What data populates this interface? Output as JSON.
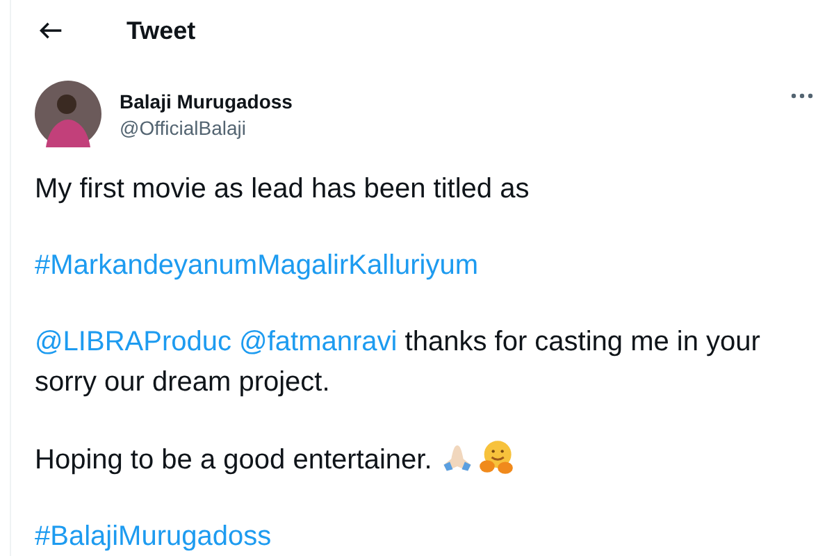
{
  "header": {
    "title": "Tweet"
  },
  "author": {
    "name": "Balaji Murugadoss",
    "handle": "@OfficialBalaji"
  },
  "paragraphs": [
    {
      "segments": [
        {
          "kind": "text",
          "text": "My first movie as lead has been titled as"
        }
      ]
    },
    {
      "segments": [
        {
          "kind": "link",
          "text": "#MarkandeyanumMagalirKalluriyum"
        }
      ]
    },
    {
      "segments": [
        {
          "kind": "link",
          "text": "@LIBRAProduc"
        },
        {
          "kind": "link",
          "text": "@fatmanravi"
        },
        {
          "kind": "text",
          "text": " thanks for casting me in your sorry our dream project."
        }
      ]
    },
    {
      "segments": [
        {
          "kind": "text",
          "text": "Hoping to be a good entertainer. "
        },
        {
          "kind": "hands"
        },
        {
          "kind": "hug"
        }
      ]
    },
    {
      "segments": [
        {
          "kind": "link",
          "text": "#BalajiMurugadoss"
        }
      ]
    }
  ]
}
